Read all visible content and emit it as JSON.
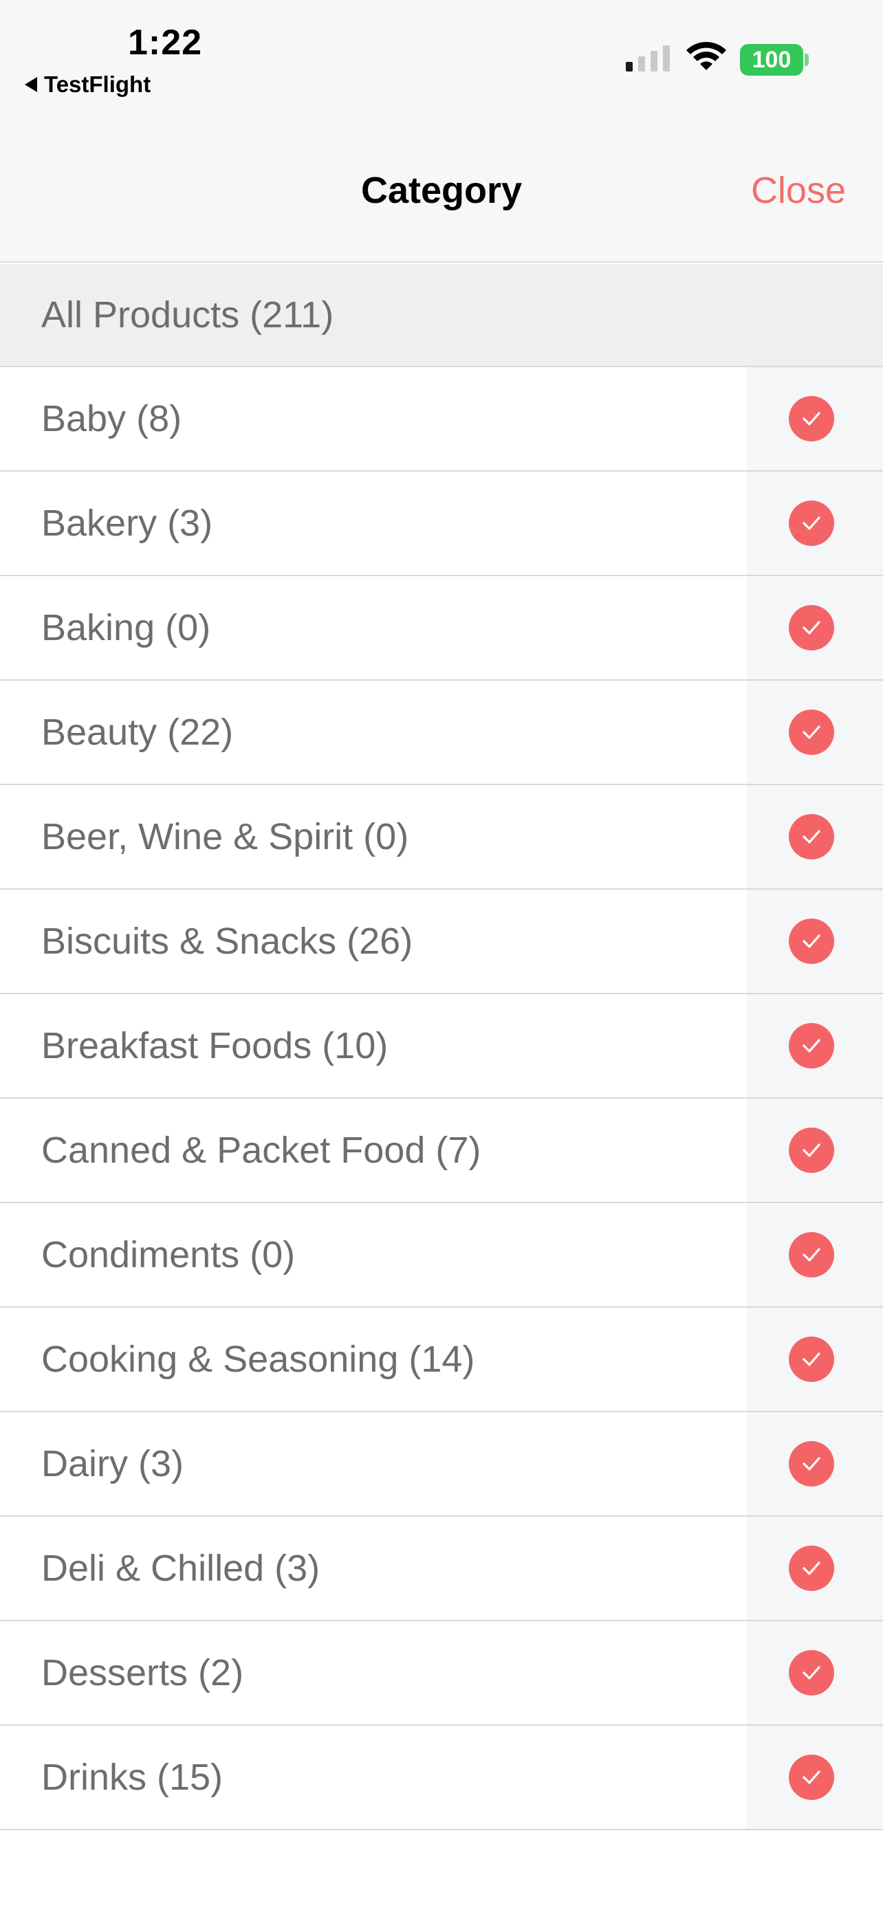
{
  "status_bar": {
    "time": "1:22",
    "back_app": "TestFlight",
    "battery": "100"
  },
  "nav": {
    "title": "Category",
    "close_label": "Close"
  },
  "colors": {
    "accent": "#f46467",
    "battery": "#34c759"
  },
  "all_products": "All Products (211)",
  "categories": [
    {
      "label": "Baby (8)",
      "checked": true
    },
    {
      "label": "Bakery (3)",
      "checked": true
    },
    {
      "label": "Baking (0)",
      "checked": true
    },
    {
      "label": "Beauty (22)",
      "checked": true
    },
    {
      "label": "Beer, Wine & Spirit (0)",
      "checked": true
    },
    {
      "label": "Biscuits & Snacks (26)",
      "checked": true
    },
    {
      "label": "Breakfast Foods (10)",
      "checked": true
    },
    {
      "label": "Canned & Packet Food (7)",
      "checked": true
    },
    {
      "label": "Condiments (0)",
      "checked": true
    },
    {
      "label": "Cooking & Seasoning (14)",
      "checked": true
    },
    {
      "label": "Dairy (3)",
      "checked": true
    },
    {
      "label": "Deli & Chilled (3)",
      "checked": true
    },
    {
      "label": "Desserts (2)",
      "checked": true
    },
    {
      "label": "Drinks (15)",
      "checked": true
    }
  ]
}
